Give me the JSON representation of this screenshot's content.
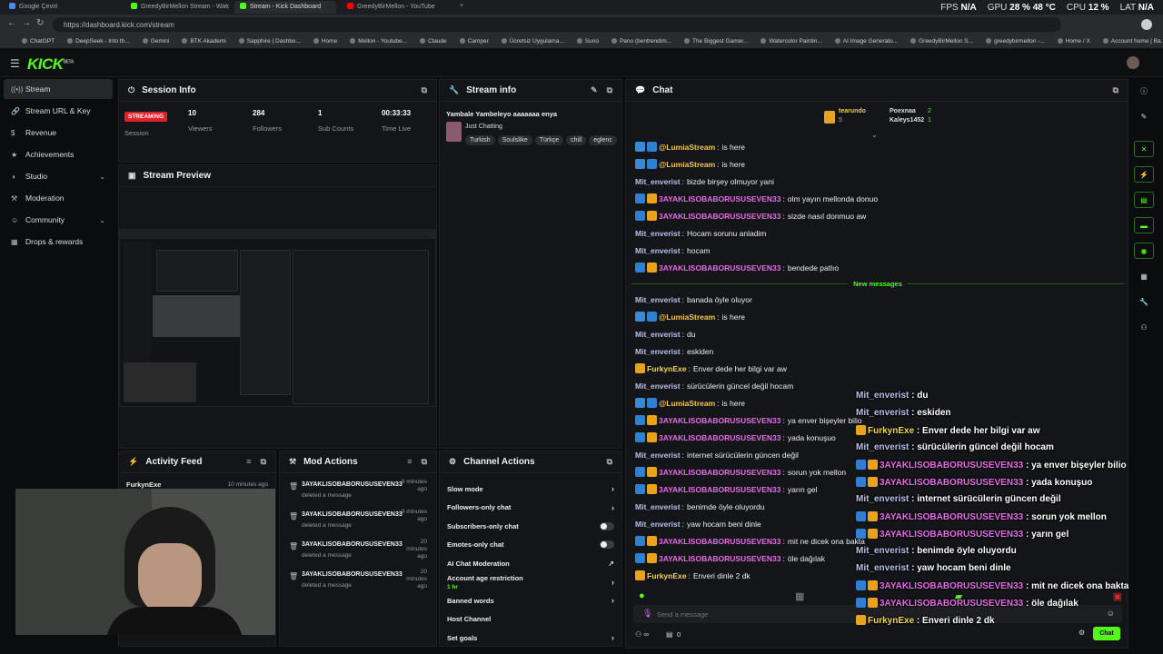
{
  "browser": {
    "tabs": [
      {
        "label": "Google Çeviri",
        "active": false,
        "color": "#4a8af4"
      },
      {
        "label": "GreedyBirMellon Stream - Watch",
        "active": false,
        "color": "#53fc18"
      },
      {
        "label": "Stream - Kick Dashboard",
        "active": true,
        "color": "#53fc18"
      },
      {
        "label": "GreedyBirMellon - YouTube",
        "active": false,
        "color": "#ff0000"
      }
    ],
    "new_tab": "+",
    "perf": {
      "fps_label": "FPS",
      "fps": "N/A",
      "gpu_label": "GPU",
      "gpu": "28 % 48 °C",
      "cpu_label": "CPU",
      "cpu": "12 %",
      "lat_label": "LAT",
      "lat": "N/A"
    },
    "url": "https://dashboard.kick.com/stream",
    "bookmarks": [
      "ChatGPT",
      "DeepSeek - Into th...",
      "Gemini",
      "BTK Akademi",
      "Sapphire | Dashbo...",
      "Home",
      "Mellon - Youtube...",
      "Claude",
      "Camper",
      "Ücretsiz Uygulama...",
      "Suno",
      "Pano (bentrendim...",
      "The Biggest Gamer...",
      "Watercolor Paintin...",
      "AI Image Generato...",
      "GreedyBirMellon S...",
      "greedybirmellon -...",
      "Home / X",
      "Account home | Ba..."
    ]
  },
  "kick": {
    "logo": "KICK",
    "logo_sup": "BETA"
  },
  "sidebar": {
    "items": [
      {
        "label": "Stream",
        "icon": "((•))",
        "active": true,
        "chevron": false
      },
      {
        "label": "Stream URL & Key",
        "icon": "🔗",
        "active": false,
        "chevron": false
      },
      {
        "label": "Revenue",
        "icon": "$",
        "active": false,
        "chevron": false
      },
      {
        "label": "Achievements",
        "icon": "★",
        "active": false,
        "chevron": false
      },
      {
        "label": "Studio",
        "icon": "◑",
        "active": false,
        "chevron": true
      },
      {
        "label": "Moderation",
        "icon": "⚒",
        "active": false,
        "chevron": false
      },
      {
        "label": "Community",
        "icon": "☺",
        "active": false,
        "chevron": true
      },
      {
        "label": "Drops & rewards",
        "icon": "▦",
        "active": false,
        "chevron": false
      }
    ]
  },
  "session": {
    "title": "Session Info",
    "status": "STREAMING",
    "session_label": "Session",
    "stats": [
      {
        "value": "10",
        "label": "Viewers"
      },
      {
        "value": "284",
        "label": "Followers"
      },
      {
        "value": "1",
        "label": "Sub Counts"
      },
      {
        "value": "00:33:33",
        "label": "Time Live"
      }
    ]
  },
  "stream_info": {
    "title": "Stream info",
    "stream_title": "Yambale Yambeleyo aaaaaaa enya",
    "category": "Just Chatting",
    "tags": [
      "Turkish",
      "Soulslike",
      "Türkçe",
      "chill",
      "eglenc"
    ]
  },
  "preview": {
    "title": "Stream Preview"
  },
  "activity": {
    "title": "Activity Feed",
    "items": [
      {
        "user": "FurkynExe",
        "time": "10 minutes ago"
      }
    ]
  },
  "mod_actions": {
    "title": "Mod Actions",
    "items": [
      {
        "user": "3AYAKLISOBABORUSUSEVEN33",
        "action": "deleted a message",
        "time": "9 minutes ago"
      },
      {
        "user": "3AYAKLISOBABORUSUSEVEN33",
        "action": "deleted a message",
        "time": "9 minutes ago"
      },
      {
        "user": "3AYAKLISOBABORUSUSEVEN33",
        "action": "deleted a message",
        "time": "20 minutes ago"
      },
      {
        "user": "3AYAKLISOBABORUSUSEVEN33",
        "action": "deleted a message",
        "time": "20 minutes ago"
      }
    ]
  },
  "channel_actions": {
    "title": "Channel Actions",
    "items": [
      {
        "label": "Slow mode",
        "control": "chevron"
      },
      {
        "label": "Followers-only chat",
        "control": "chevron"
      },
      {
        "label": "Subscribers-only chat",
        "control": "toggle"
      },
      {
        "label": "Emotes-only chat",
        "control": "toggle"
      },
      {
        "label": "AI Chat Moderation",
        "control": "external"
      },
      {
        "label": "Account age restriction",
        "sub": "1 hr",
        "control": "chevron"
      },
      {
        "label": "Banned words",
        "control": "chevron"
      },
      {
        "label": "Host Channel",
        "control": "none"
      },
      {
        "label": "Set goals",
        "control": "chevron"
      }
    ]
  },
  "chat": {
    "title": "Chat",
    "leaders": [
      {
        "name": "tearundo",
        "count": "5"
      },
      {
        "name": "Poexnaa",
        "count": "2"
      },
      {
        "name": "Kaleys1452",
        "count": "1"
      }
    ],
    "new_messages_label": "New messages",
    "messages": [
      {
        "user": "@LumiaStream",
        "cls": "nm-lumia",
        "badges": [
          "b-bot",
          "b-vip"
        ],
        "text": "is here"
      },
      {
        "user": "@LumiaStream",
        "cls": "nm-lumia",
        "badges": [
          "b-bot",
          "b-vip"
        ],
        "text": "is here"
      },
      {
        "user": "Mit_enverist",
        "cls": "nm-mit",
        "badges": [],
        "text": "bizde birşey olmuyor yani"
      },
      {
        "user": "3AYAKLISOBABORUSUSEVEN33",
        "cls": "nm-3aya",
        "badges": [
          "b-vip",
          "b-crown"
        ],
        "text": "olm yayın mellonda donuo"
      },
      {
        "user": "3AYAKLISOBABORUSUSEVEN33",
        "cls": "nm-3aya",
        "badges": [
          "b-vip",
          "b-crown"
        ],
        "text": "sizde nasıl donmuo aw"
      },
      {
        "user": "Mit_enverist",
        "cls": "nm-mit",
        "badges": [],
        "text": "Hocam sorunu anladim"
      },
      {
        "user": "Mit_enverist",
        "cls": "nm-mit",
        "badges": [],
        "text": "hocam"
      },
      {
        "user": "3AYAKLISOBABORUSUSEVEN33",
        "cls": "nm-3aya",
        "badges": [
          "b-vip",
          "b-crown"
        ],
        "text": "bendede patlıo"
      }
    ],
    "messages_new": [
      {
        "user": "Mit_enverist",
        "cls": "nm-mit",
        "badges": [],
        "text": "banada öyle oluyor"
      },
      {
        "user": "@LumiaStream",
        "cls": "nm-lumia",
        "badges": [
          "b-bot",
          "b-vip"
        ],
        "text": "is here"
      },
      {
        "user": "Mit_enverist",
        "cls": "nm-mit",
        "badges": [],
        "text": "du"
      },
      {
        "user": "Mit_enverist",
        "cls": "nm-mit",
        "badges": [],
        "text": "eskiden"
      },
      {
        "user": "FurkynExe",
        "cls": "nm-furky",
        "badges": [
          "b-crown"
        ],
        "text": "Enver dede her bilgi var aw"
      },
      {
        "user": "Mit_enverist",
        "cls": "nm-mit",
        "badges": [],
        "text": "sürücülerin güncel değil hocam"
      },
      {
        "user": "@LumiaStream",
        "cls": "nm-lumia",
        "badges": [
          "b-bot",
          "b-vip"
        ],
        "text": "is here"
      },
      {
        "user": "3AYAKLISOBABORUSUSEVEN33",
        "cls": "nm-3aya",
        "badges": [
          "b-vip",
          "b-crown"
        ],
        "text": "ya enver bişeyler bilio"
      },
      {
        "user": "3AYAKLISOBABORUSUSEVEN33",
        "cls": "nm-3aya",
        "badges": [
          "b-vip",
          "b-crown"
        ],
        "text": "yada konuşuo"
      },
      {
        "user": "Mit_enverist",
        "cls": "nm-mit",
        "badges": [],
        "text": "internet sürücülerin güncen değil"
      },
      {
        "user": "3AYAKLISOBABORUSUSEVEN33",
        "cls": "nm-3aya",
        "badges": [
          "b-vip",
          "b-crown"
        ],
        "text": "sorun yok mellon"
      },
      {
        "user": "3AYAKLISOBABORUSUSEVEN33",
        "cls": "nm-3aya",
        "badges": [
          "b-vip",
          "b-crown"
        ],
        "text": "yarın gel"
      },
      {
        "user": "Mit_enverist",
        "cls": "nm-mit",
        "badges": [],
        "text": "benimde öyle oluyordu"
      },
      {
        "user": "Mit_enverist",
        "cls": "nm-mit",
        "badges": [],
        "text": "yaw hocam beni dinle"
      },
      {
        "user": "3AYAKLISOBABORUSUSEVEN33",
        "cls": "nm-3aya",
        "badges": [
          "b-vip",
          "b-crown"
        ],
        "text": "mit ne dicek ona bakta"
      },
      {
        "user": "3AYAKLISOBABORUSUSEVEN33",
        "cls": "nm-3aya",
        "badges": [
          "b-vip",
          "b-crown"
        ],
        "text": "öle dağılak"
      },
      {
        "user": "FurkynExe",
        "cls": "nm-furky",
        "badges": [
          "b-crown"
        ],
        "text": "Enveri dinle 2 dk"
      }
    ],
    "input_placeholder": "Send a message",
    "viewer_count": "0",
    "send_label": "Chat"
  },
  "overlay_chat": [
    {
      "user": "Mit_enverist",
      "cls": "nm-mit",
      "badges": [],
      "text": "du"
    },
    {
      "user": "Mit_enverist",
      "cls": "nm-mit",
      "badges": [],
      "text": "eskiden"
    },
    {
      "user": "FurkynExe",
      "cls": "nm-furky",
      "badges": [
        "b-crown"
      ],
      "text": "Enver dede her bilgi var aw"
    },
    {
      "user": "Mit_enverist",
      "cls": "nm-mit",
      "badges": [],
      "text": "sürücülerin güncel değil hocam"
    },
    {
      "user": "3AYAKLISOBABORUSUSEVEN33",
      "cls": "nm-3aya",
      "badges": [
        "b-vip",
        "b-crown"
      ],
      "text": "ya enver bişeyler bilio"
    },
    {
      "user": "3AYAKLISOBABORUSUSEVEN33",
      "cls": "nm-3aya",
      "badges": [
        "b-vip",
        "b-crown"
      ],
      "text": "yada konuşuo"
    },
    {
      "user": "Mit_enverist",
      "cls": "nm-mit",
      "badges": [],
      "text": "internet sürücülerin güncen değil"
    },
    {
      "user": "3AYAKLISOBABORUSUSEVEN33",
      "cls": "nm-3aya",
      "badges": [
        "b-vip",
        "b-crown"
      ],
      "text": "sorun yok mellon"
    },
    {
      "user": "3AYAKLISOBABORUSUSEVEN33",
      "cls": "nm-3aya",
      "badges": [
        "b-vip",
        "b-crown"
      ],
      "text": "yarın gel"
    },
    {
      "user": "Mit_enverist",
      "cls": "nm-mit",
      "badges": [],
      "text": "benimde öyle oluyordu"
    },
    {
      "user": "Mit_enverist",
      "cls": "nm-mit",
      "badges": [],
      "text": "yaw hocam beni dinle"
    },
    {
      "user": "3AYAKLISOBABORUSUSEVEN33",
      "cls": "nm-3aya",
      "badges": [
        "b-vip",
        "b-crown"
      ],
      "text": "mit ne dicek ona bakta"
    },
    {
      "user": "3AYAKLISOBABORUSUSEVEN33",
      "cls": "nm-3aya",
      "badges": [
        "b-vip",
        "b-crown"
      ],
      "text": "öle dağılak"
    },
    {
      "user": "FurkynExe",
      "cls": "nm-furky",
      "badges": [
        "b-crown"
      ],
      "text": "Enveri dinle 2 dk"
    }
  ],
  "colors": {
    "accent": "#53fc18",
    "live": "#e0222a",
    "bg": "#0b0c0e",
    "panel": "#141518"
  }
}
